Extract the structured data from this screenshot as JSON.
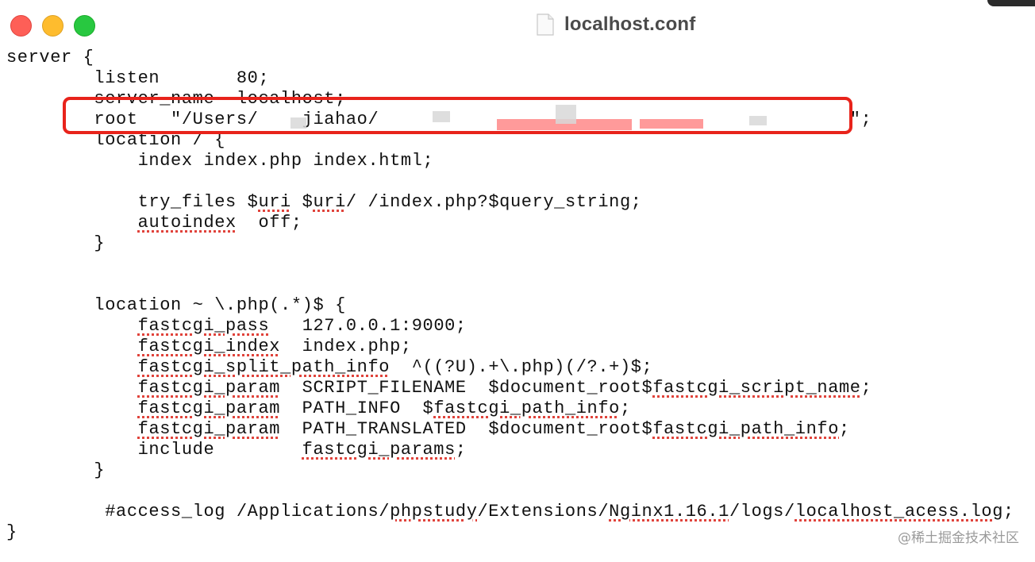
{
  "window": {
    "title": "localhost.conf",
    "file_icon": "document-icon",
    "controls": [
      "close",
      "minimize",
      "zoom"
    ]
  },
  "file_lines": [
    {
      "id": "l1",
      "text": "server {"
    },
    {
      "id": "l2",
      "text": "        listen       80;"
    },
    {
      "id": "l3",
      "text": "        server_name  localhost;"
    },
    {
      "id": "l4",
      "text": "        root   \"/Users/    jiahao/                                           \";"
    },
    {
      "id": "l5",
      "text": "        location / {"
    },
    {
      "id": "l6",
      "text": "            index index.php index.html;"
    },
    {
      "id": "l7",
      "text": ""
    },
    {
      "id": "l8",
      "text": "            try_files $uri $uri/ /index.php?$query_string;"
    },
    {
      "id": "l9",
      "text": "            autoindex  off;"
    },
    {
      "id": "l10",
      "text": "        }"
    },
    {
      "id": "l11",
      "text": ""
    },
    {
      "id": "l12",
      "text": ""
    },
    {
      "id": "l13",
      "text": "        location ~ \\.php(.*)$ {"
    },
    {
      "id": "l14",
      "text": "            fastcgi_pass   127.0.0.1:9000;"
    },
    {
      "id": "l15",
      "text": "            fastcgi_index  index.php;"
    },
    {
      "id": "l16",
      "text": "            fastcgi_split_path_info  ^((?U).+\\.php)(/?.+)$;"
    },
    {
      "id": "l17",
      "text": "            fastcgi_param  SCRIPT_FILENAME  $document_root$fastcgi_script_name;"
    },
    {
      "id": "l18",
      "text": "            fastcgi_param  PATH_INFO  $fastcgi_path_info;"
    },
    {
      "id": "l19",
      "text": "            fastcgi_param  PATH_TRANSLATED  $document_root$fastcgi_path_info;"
    },
    {
      "id": "l20",
      "text": "            include        fastcgi_params;"
    },
    {
      "id": "l21",
      "text": "        }"
    },
    {
      "id": "l22",
      "text": ""
    },
    {
      "id": "l23",
      "text": "         #access_log /Applications/phpstudy/Extensions/Nginx1.16.1/logs/localhost_acess.log;"
    },
    {
      "id": "l24",
      "text": "}"
    }
  ],
  "annotation": {
    "highlight_color": "#e8231b",
    "target_line": "l4"
  },
  "watermark": "@稀土掘金技术社区"
}
